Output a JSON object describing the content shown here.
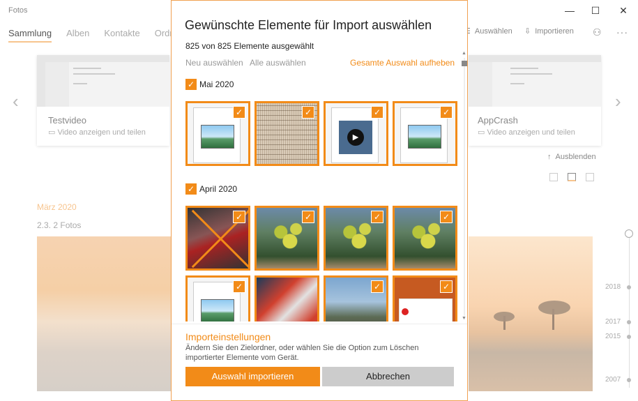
{
  "app": {
    "title": "Fotos",
    "nav": [
      "Sammlung",
      "Alben",
      "Kontakte",
      "Ordne"
    ],
    "toolbar": {
      "select_label": "Auswählen",
      "import_label": "Importieren",
      "more": "···"
    },
    "window_controls": {
      "minimize": "—",
      "maximize": "☐",
      "close": "✕"
    },
    "cards": [
      {
        "title": "Testvideo",
        "subtitle": "Video anzeigen und teilen"
      },
      {
        "title": "AppCrash",
        "subtitle": "Video anzeigen und teilen"
      }
    ],
    "hide_label": "Ausblenden",
    "month_label": "März 2020",
    "day_label": "2.3.   2 Fotos",
    "timeline_years": [
      "2018",
      "2017",
      "2015",
      "2007"
    ],
    "arrows": {
      "left": "‹",
      "right": "›"
    }
  },
  "dialog": {
    "title": "Gewünschte Elemente für Import auswählen",
    "count": "825 von 825 Elemente ausgewählt",
    "links": {
      "reselect": "Neu auswählen",
      "select_all": "Alle auswählen",
      "clear_all": "Gesamte Auswahl aufheben"
    },
    "groups": [
      {
        "label": "Mai 2020",
        "checked": true
      },
      {
        "label": "April 2020",
        "checked": true
      }
    ],
    "check_glyph": "✓",
    "play_glyph": "▶",
    "settings_title": "Importeinstellungen",
    "settings_desc": "Ändern Sie den Zielordner, oder wählen Sie die Option zum Löschen importierter Elemente vom Gerät.",
    "buttons": {
      "import": "Auswahl importieren",
      "cancel": "Abbrechen"
    },
    "colors": {
      "accent": "#f28b18",
      "secondary_button": "#cccccc"
    }
  }
}
